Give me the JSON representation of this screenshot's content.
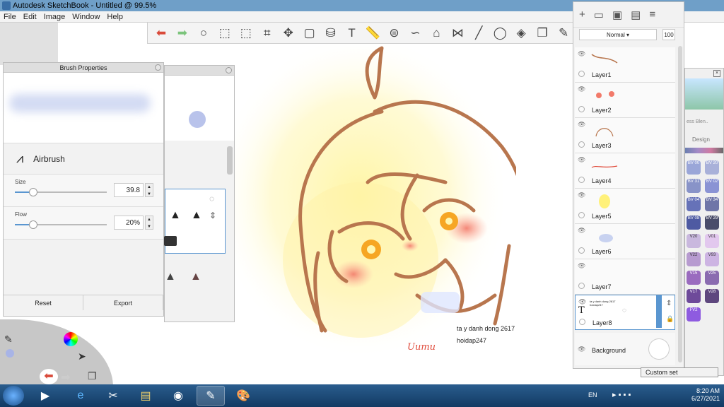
{
  "app": {
    "title": "Autodesk SketchBook - Untitled @ 99.5%"
  },
  "menu": [
    "File",
    "Edit",
    "Image",
    "Window",
    "Help"
  ],
  "toolbar": {
    "icons": [
      "undo-icon",
      "redo-icon",
      "zoom-icon",
      "select-icon",
      "lasso-select-icon",
      "crop-icon",
      "transform-icon",
      "distort-icon",
      "fill-bucket-icon",
      "text-icon",
      "ruler-icon",
      "ellipse-guide-icon",
      "french-curve-icon",
      "perspective-icon",
      "symmetry-icon",
      "line-icon",
      "circle-icon",
      "shapes-icon",
      "copy-icon",
      "brush-icon"
    ]
  },
  "brush_properties": {
    "title": "Brush Properties",
    "brush_name": "Airbrush",
    "size_label": "Size",
    "size_value": "39.8",
    "size_fraction": 0.2,
    "flow_label": "Flow",
    "flow_value": "20%",
    "flow_fraction": 0.2,
    "reset_label": "Reset",
    "export_label": "Export"
  },
  "canvas": {
    "annotation1": "ta y danh dong 2617",
    "annotation2": "hoidap247",
    "signature": "Uumu"
  },
  "layers": {
    "blend_mode": "Normal",
    "opacity": "100",
    "items": [
      {
        "name": "Layer1"
      },
      {
        "name": "Layer2"
      },
      {
        "name": "Layer3"
      },
      {
        "name": "Layer4"
      },
      {
        "name": "Layer5"
      },
      {
        "name": "Layer6"
      },
      {
        "name": "Layer7"
      },
      {
        "name": "Layer8"
      }
    ],
    "background_label": "Background"
  },
  "copic": {
    "header_text": "Design",
    "partial_label": "ess Blen..",
    "swatches": [
      "BV 00",
      "BV 20",
      "BV 31",
      "BV 02",
      "BV 04",
      "BV 34",
      "BV 08",
      "BV 29",
      "V20",
      "V01",
      "V22",
      "V93",
      "V15",
      "V25",
      "V17",
      "V28",
      "FV2"
    ],
    "custom_set": "Custom set"
  },
  "taskbar": {
    "lang": "EN",
    "time": "8:20 AM",
    "date": "6/27/2021"
  }
}
